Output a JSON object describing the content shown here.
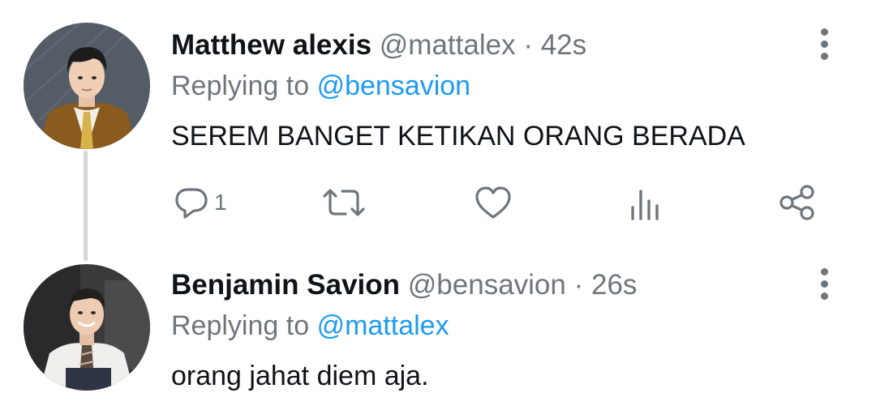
{
  "tweets": [
    {
      "name": "Matthew alexis",
      "handle": "@mattalex",
      "separator": "·",
      "time": "42s",
      "replying_prefix": "Replying to",
      "replying_to": "@bensavion",
      "text": "SEREM BANGET KETIKAN ORANG BERADA",
      "avatar_description": "man in brown suit",
      "actions": {
        "reply_count": "1",
        "retweet_count": "",
        "like_count": ""
      }
    },
    {
      "name": "Benjamin Savion",
      "handle": "@bensavion",
      "separator": "·",
      "time": "26s",
      "replying_prefix": "Replying to",
      "replying_to": "@mattalex",
      "text": "orang jahat diem aja.",
      "avatar_description": "man in white shirt with striped tie"
    }
  ],
  "icons": {
    "reply": "reply-icon",
    "retweet": "retweet-icon",
    "like": "heart-icon",
    "analytics": "analytics-icon",
    "share": "share-icon",
    "more": "more-vertical-icon"
  },
  "colors": {
    "text_primary": "#0f1419",
    "text_secondary": "#6e767d",
    "link": "#1d9bf0",
    "thread_line": "#d3d6da",
    "icon": "#6e767d"
  }
}
